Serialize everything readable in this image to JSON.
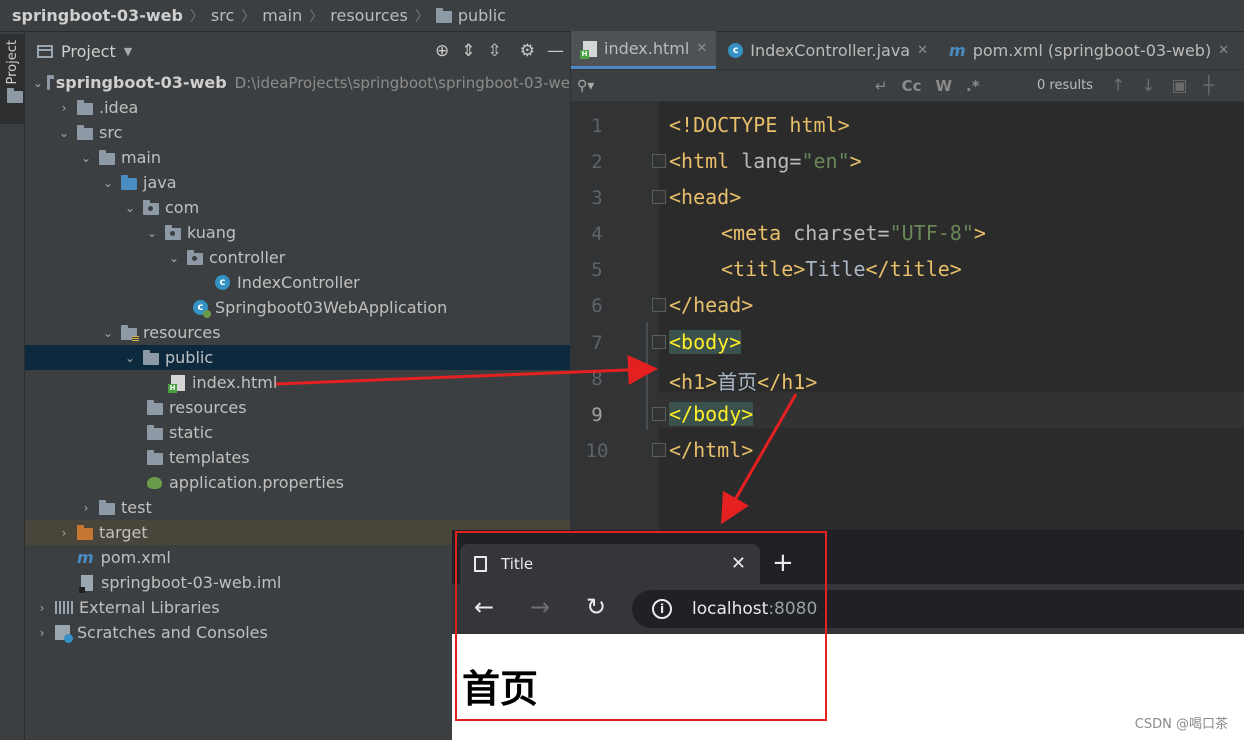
{
  "breadcrumb": [
    "springboot-03-web",
    "src",
    "main",
    "resources",
    "public"
  ],
  "sidebar": {
    "tab_label": "Project"
  },
  "project_panel": {
    "title": "Project"
  },
  "tree": [
    {
      "label": "springboot-03-web",
      "path": "D:\\ideaProjects\\springboot\\springboot-03-we"
    },
    {
      "label": ".idea"
    },
    {
      "label": "src"
    },
    {
      "label": "main"
    },
    {
      "label": "java"
    },
    {
      "label": "com"
    },
    {
      "label": "kuang"
    },
    {
      "label": "controller"
    },
    {
      "label": "IndexController"
    },
    {
      "label": "Springboot03WebApplication"
    },
    {
      "label": "resources"
    },
    {
      "label": "public"
    },
    {
      "label": "index.html"
    },
    {
      "label": "resources"
    },
    {
      "label": "static"
    },
    {
      "label": "templates"
    },
    {
      "label": "application.properties"
    },
    {
      "label": "test"
    },
    {
      "label": "target"
    },
    {
      "label": "pom.xml"
    },
    {
      "label": "springboot-03-web.iml"
    },
    {
      "label": "External Libraries"
    },
    {
      "label": "Scratches and Consoles"
    }
  ],
  "editor_tabs": [
    {
      "label": "index.html"
    },
    {
      "label": "IndexController.java"
    },
    {
      "label": "pom.xml (springboot-03-web)"
    }
  ],
  "search": {
    "results": "0 results"
  },
  "code": {
    "line_numbers": [
      "1",
      "2",
      "3",
      "4",
      "5",
      "6",
      "7",
      "8",
      "9",
      "10"
    ],
    "doctype": "<!DOCTYPE html>",
    "html_open": "<html",
    "lang_attr": " lang=",
    "lang_val": "\"en\"",
    "gt": ">",
    "head_open": "<head>",
    "meta_open": "<meta",
    "charset_attr": " charset=",
    "charset_val": "\"UTF-8\"",
    "title_open": "<title>",
    "title_text": "Title",
    "title_close": "</title>",
    "head_close": "</head>",
    "body_open": "<body>",
    "h1_open": "<h1>",
    "h1_text": "首页",
    "h1_close": "</h1>",
    "body_close": "</body>",
    "html_close": "</html>"
  },
  "browser": {
    "tab_title": "Title",
    "url_host": "localhost",
    "url_port": ":8080",
    "heading": "首页"
  },
  "watermark": "CSDN @喝口茶",
  "colors": {
    "accent": "#4a88c7",
    "arrow": "#e52020",
    "selection": "#0d293e"
  }
}
